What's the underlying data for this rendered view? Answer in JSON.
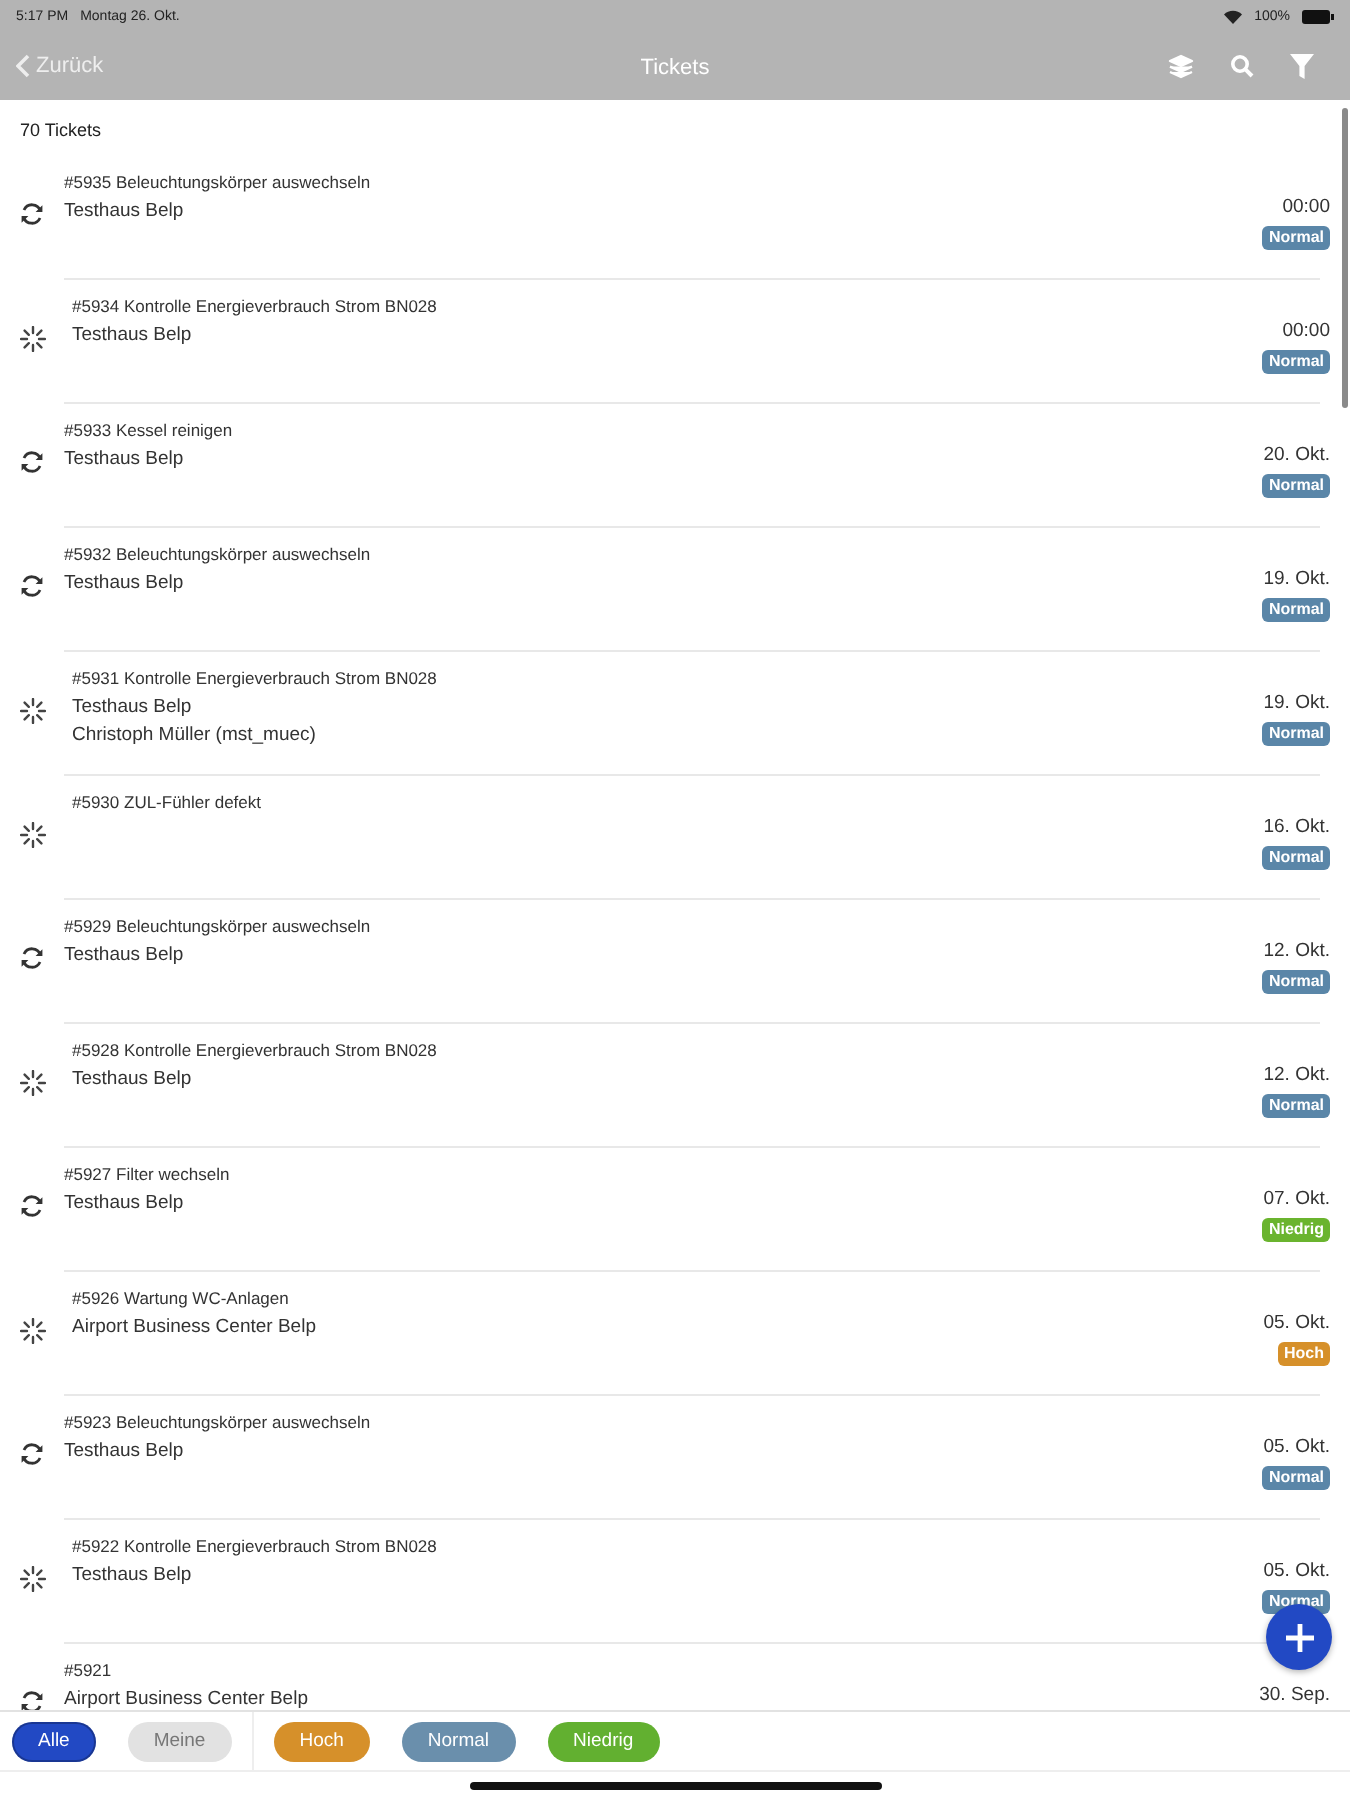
{
  "status_bar": {
    "time": "5:17 PM",
    "date": "Montag 26. Okt.",
    "battery": "100%"
  },
  "nav": {
    "back": "Zurück",
    "title": "Tickets"
  },
  "count": "70 Tickets",
  "tickets": [
    {
      "kind": "cycle",
      "title": "#5935  Beleuchtungskörper auswechseln",
      "lines": [
        "Testhaus Belp"
      ],
      "date": "00:00",
      "priority": "Normal",
      "color": "#5a86a8"
    },
    {
      "kind": "burst",
      "title": "#5934  Kontrolle Energieverbrauch Strom BN028",
      "lines": [
        "Testhaus Belp"
      ],
      "date": "00:00",
      "priority": "Normal",
      "color": "#5a86a8"
    },
    {
      "kind": "cycle",
      "title": "#5933  Kessel reinigen",
      "lines": [
        "Testhaus Belp"
      ],
      "date": "20. Okt.",
      "priority": "Normal",
      "color": "#5a86a8"
    },
    {
      "kind": "cycle",
      "title": "#5932  Beleuchtungskörper auswechseln",
      "lines": [
        "Testhaus Belp"
      ],
      "date": "19. Okt.",
      "priority": "Normal",
      "color": "#5a86a8"
    },
    {
      "kind": "burst",
      "title": "#5931  Kontrolle Energieverbrauch Strom BN028",
      "lines": [
        "Testhaus Belp",
        "Christoph Müller (mst_muec)"
      ],
      "date": "19. Okt.",
      "priority": "Normal",
      "color": "#5a86a8"
    },
    {
      "kind": "burst",
      "title": "#5930  ZUL-Fühler defekt",
      "date": "16. Okt.",
      "priority": "Normal",
      "color": "#5a86a8"
    },
    {
      "kind": "cycle",
      "title": "#5929  Beleuchtungskörper auswechseln",
      "lines": [
        "Testhaus Belp"
      ],
      "date": "12. Okt.",
      "priority": "Normal",
      "color": "#5a86a8"
    },
    {
      "kind": "burst",
      "title": "#5928  Kontrolle Energieverbrauch Strom BN028",
      "lines": [
        "Testhaus Belp"
      ],
      "date": "12. Okt.",
      "priority": "Normal",
      "color": "#5a86a8"
    },
    {
      "kind": "cycle",
      "title": "#5927  Filter wechseln",
      "lines": [
        "Testhaus Belp"
      ],
      "date": "07. Okt.",
      "priority": "Niedrig",
      "color": "#6ab42e"
    },
    {
      "kind": "burst",
      "title": "#5926  Wartung WC-Anlagen",
      "lines": [
        "Airport Business Center Belp"
      ],
      "date": "05. Okt.",
      "priority": "Hoch",
      "color": "#d6902a"
    },
    {
      "kind": "cycle",
      "title": "#5923  Beleuchtungskörper auswechseln",
      "lines": [
        "Testhaus Belp"
      ],
      "date": "05. Okt.",
      "priority": "Normal",
      "color": "#5a86a8"
    },
    {
      "kind": "burst",
      "title": "#5922  Kontrolle Energieverbrauch Strom BN028",
      "lines": [
        "Testhaus Belp"
      ],
      "date": "05. Okt.",
      "priority": "Normal",
      "color": "#5a86a8"
    },
    {
      "kind": "cycle",
      "title": "#5921",
      "lines": [
        "Airport Business Center Belp"
      ],
      "date": "30. Sep."
    }
  ],
  "filters": [
    {
      "label": "Alle",
      "selected": true,
      "color": "#2249c4"
    },
    {
      "label": "Meine",
      "selected": false,
      "color": "#e2e2e2"
    },
    {
      "label": "Hoch",
      "selected": false,
      "color": "#d6902a"
    },
    {
      "label": "Normal",
      "selected": false,
      "color": "#6a8fac"
    },
    {
      "label": "Niedrig",
      "selected": false,
      "color": "#62b030"
    }
  ]
}
